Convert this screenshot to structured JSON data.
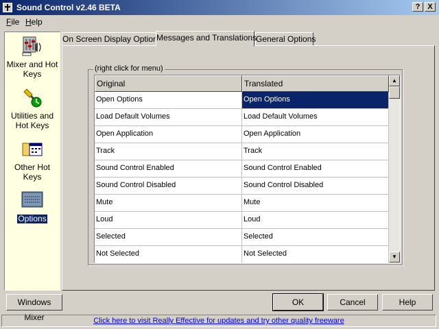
{
  "window": {
    "title": "Sound Control v2.46 BETA",
    "help_glyph": "?",
    "close_glyph": "X"
  },
  "menu": [
    {
      "label": "File"
    },
    {
      "label": "Help"
    }
  ],
  "sidebar": {
    "items": [
      {
        "line1": "Mixer and Hot",
        "line2": "Keys"
      },
      {
        "line1": "Utilities and",
        "line2": "Hot Keys"
      },
      {
        "line1": "Other Hot",
        "line2": "Keys"
      },
      {
        "line1": "Options",
        "line2": ""
      }
    ]
  },
  "tabs": [
    {
      "label": "On Screen Display Options"
    },
    {
      "label": "Messages and Translations"
    },
    {
      "label": "General Options"
    }
  ],
  "group": {
    "label": "(right click for menu)"
  },
  "grid": {
    "columns": [
      "Original",
      "Translated"
    ],
    "rows": [
      {
        "original": "Open Options",
        "translated": "Open Options"
      },
      {
        "original": "Load Default Volumes",
        "translated": "Load Default Volumes"
      },
      {
        "original": "Open Application",
        "translated": "Open Application"
      },
      {
        "original": "Track",
        "translated": "Track"
      },
      {
        "original": "Sound Control Enabled",
        "translated": "Sound Control Enabled"
      },
      {
        "original": "Sound Control Disabled",
        "translated": "Sound Control Disabled"
      },
      {
        "original": "Mute",
        "translated": "Mute"
      },
      {
        "original": "Loud",
        "translated": "Loud"
      },
      {
        "original": "Selected",
        "translated": "Selected"
      },
      {
        "original": "Not Selected",
        "translated": "Not Selected"
      }
    ]
  },
  "buttons": {
    "windows_mixer": "Windows Mixer",
    "ok": "OK",
    "cancel": "Cancel",
    "help": "Help"
  },
  "status": {
    "link_text": "Click here to visit Really Effective for updates and try other quality freeware"
  },
  "colors": {
    "selection": "#0a246a",
    "face": "#d4d0c8",
    "sidebar_bg": "#ffffe1",
    "link": "#0000ff"
  }
}
